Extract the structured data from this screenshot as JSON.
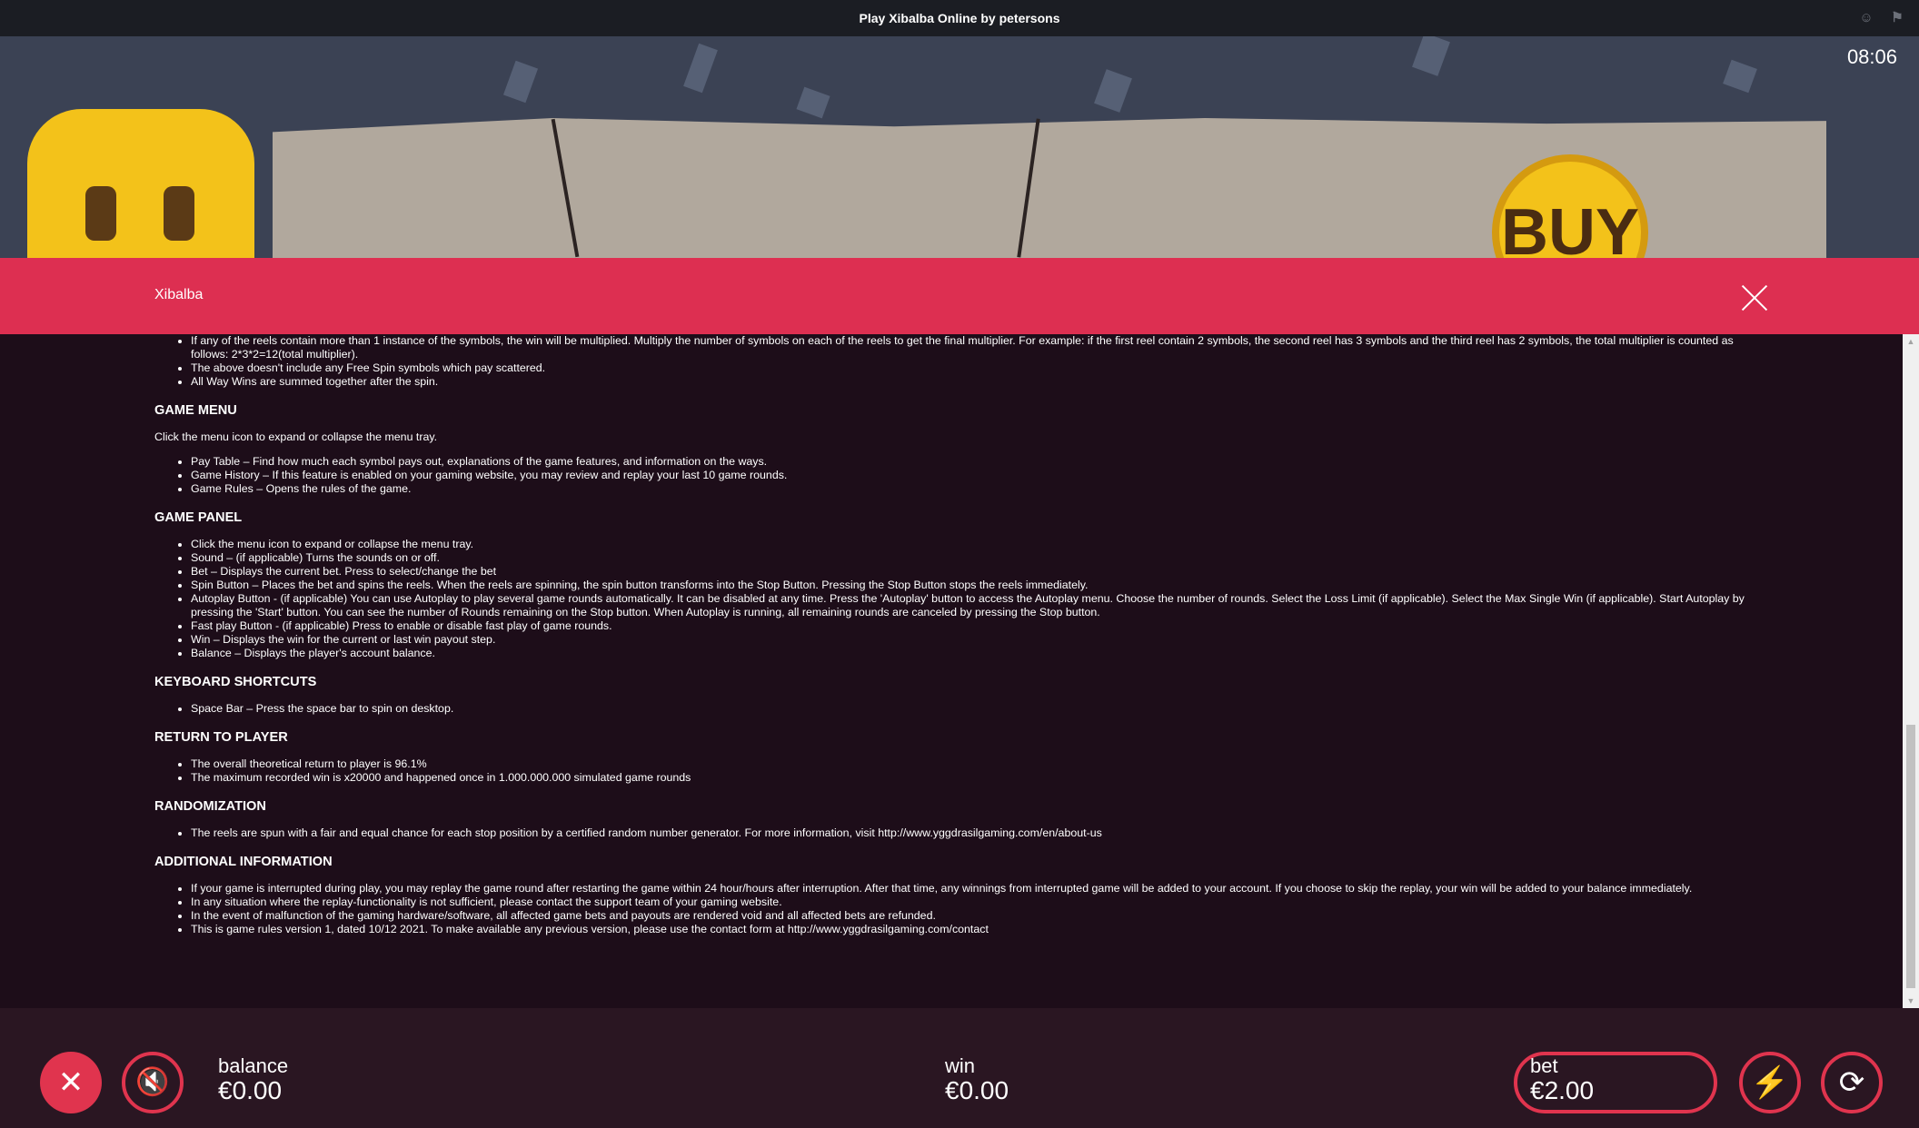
{
  "window": {
    "title": "Play Xibalba Online by petersons"
  },
  "game": {
    "clock": "08:06",
    "buy_label": "BUY"
  },
  "modal": {
    "title": "Xibalba",
    "intro_bullets": [
      "If any of the reels contain more than 1 instance of the symbols, the win will be multiplied. Multiply the number of symbols on each of the reels to get the final multiplier. For example: if the first reel contain 2 symbols, the second reel has 3 symbols and the third reel has 2 symbols, the total multiplier is counted as follows: 2*3*2=12(total multiplier).",
      "The above doesn't include any Free Spin symbols which pay scattered.",
      "All Way Wins are summed together after the spin."
    ],
    "sections": [
      {
        "heading": "GAME MENU",
        "paragraph": "Click the menu icon to expand or collapse the menu tray.",
        "bullets": [
          "Pay Table – Find how much each symbol pays out, explanations of the game features, and information on the ways.",
          "Game History – If this feature is enabled on your gaming website, you may review and replay your last 10 game rounds.",
          "Game Rules – Opens the rules of the game."
        ]
      },
      {
        "heading": "GAME PANEL",
        "bullets": [
          "Click the menu icon to expand or collapse the menu tray.",
          "Sound – (if applicable) Turns the sounds on or off.",
          "Bet – Displays the current bet. Press to select/change the bet",
          "Spin Button – Places the bet and spins the reels. When the reels are spinning, the spin button transforms into the Stop Button. Pressing the Stop Button stops the reels immediately.",
          "Autoplay Button - (if applicable) You can use Autoplay to play several game rounds automatically. It can be disabled at any time. Press the 'Autoplay' button to access the Autoplay menu. Choose the number of rounds. Select the Loss Limit (if applicable). Select the Max Single Win (if applicable). Start Autoplay by pressing the 'Start' button. You can see the number of Rounds remaining on the Stop button. When Autoplay is running, all remaining rounds are canceled by pressing the Stop button.",
          "Fast play Button - (if applicable) Press to enable or disable fast play of game rounds.",
          "Win – Displays the win for the current or last win payout step.",
          "Balance – Displays the player's account balance."
        ]
      },
      {
        "heading": "KEYBOARD SHORTCUTS",
        "bullets": [
          "Space Bar – Press the space bar to spin on desktop."
        ]
      },
      {
        "heading": "RETURN TO PLAYER",
        "bullets": [
          "The overall theoretical return to player is 96.1%",
          "The maximum recorded win is x20000 and happened once in 1.000.000.000 simulated game rounds"
        ]
      },
      {
        "heading": "RANDOMIZATION",
        "bullets": [
          "The reels are spun with a fair and equal chance for each stop position by a certified random number generator. For more information, visit http://www.yggdrasilgaming.com/en/about-us"
        ]
      },
      {
        "heading": "ADDITIONAL INFORMATION",
        "bullets": [
          "If your game is interrupted during play, you may replay the game round after restarting the game within 24 hour/hours after interruption. After that time, any winnings from interrupted game will be added to your account. If you choose to skip the replay, your win will be added to your balance immediately.",
          "In any situation where the replay-functionality is not sufficient, please contact the support team of your gaming website.",
          "In the event of malfunction of the gaming hardware/software, all affected game bets and payouts are rendered void and all affected bets are refunded.",
          "This is game rules version 1, dated 10/12 2021. To make available any previous version, please use the contact form at http://www.yggdrasilgaming.com/contact"
        ]
      }
    ]
  },
  "bottom": {
    "balance_label": "balance",
    "balance_value": "€0.00",
    "win_label": "win",
    "win_value": "€0.00",
    "bet_label": "bet",
    "bet_value": "€2.00"
  },
  "colors": {
    "accent": "#dd2f51",
    "panel": "#1d0d19"
  }
}
